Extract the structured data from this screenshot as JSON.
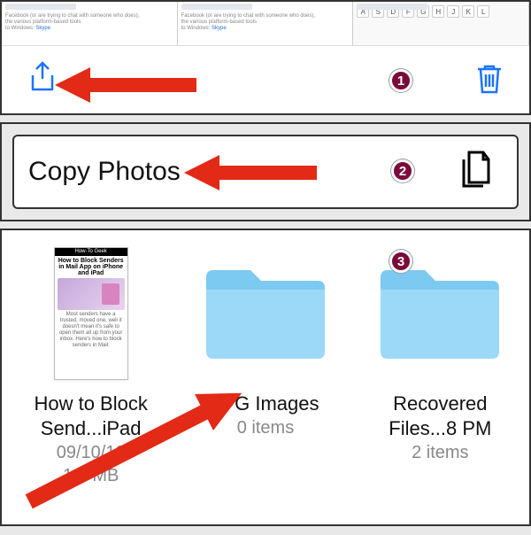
{
  "thumbstrip": {
    "link_label": "Skype",
    "windows_text": "to Windows:",
    "keys": [
      "A",
      "S",
      "D",
      "F",
      "G",
      "H",
      "J",
      "K",
      "L"
    ]
  },
  "share_sheet": {
    "copy_label": "Copy Photos"
  },
  "files": {
    "items": [
      {
        "name_line1": "How to Block",
        "name_line2": "Send...iPad",
        "meta1": "09/10/19",
        "meta2": "1.3 MB",
        "preview_header": "How-To Geek",
        "preview_title": "How to Block Senders in Mail App on iPhone and iPad"
      },
      {
        "name_line1": "JPG Images",
        "meta1": "0 items"
      },
      {
        "name_line1": "Recovered",
        "name_line2": "Files...8 PM",
        "meta1": "2 items"
      }
    ]
  },
  "badges": {
    "b1": "1",
    "b2": "2",
    "b3": "3"
  }
}
